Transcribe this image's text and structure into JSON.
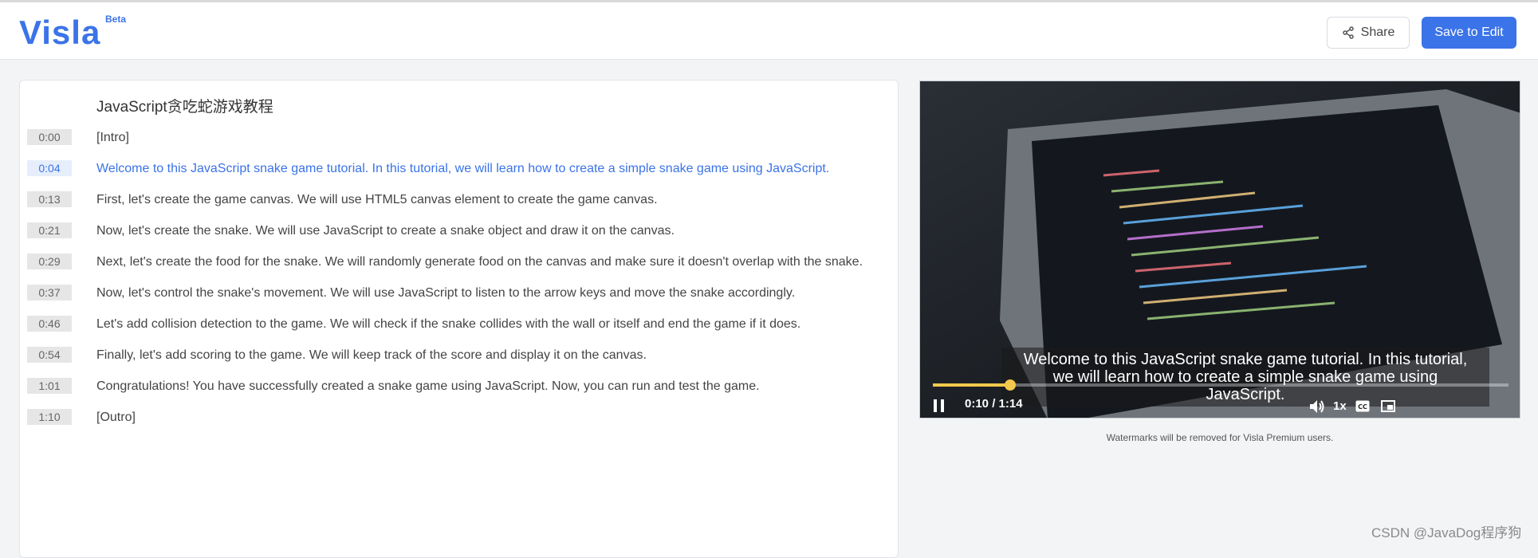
{
  "header": {
    "logo": "Visla",
    "beta": "Beta",
    "share_label": "Share",
    "save_label": "Save to Edit"
  },
  "transcript": {
    "title": "JavaScript贪吃蛇游戏教程",
    "active_index": 1,
    "rows": [
      {
        "time": "0:00",
        "text": "[Intro]"
      },
      {
        "time": "0:04",
        "text": "Welcome to this JavaScript snake game tutorial. In this tutorial, we will learn how to create a simple snake game using JavaScript."
      },
      {
        "time": "0:13",
        "text": "First, let's create the game canvas. We will use HTML5 canvas element to create the game canvas."
      },
      {
        "time": "0:21",
        "text": "Now, let's create the snake. We will use JavaScript to create a snake object and draw it on the canvas."
      },
      {
        "time": "0:29",
        "text": "Next, let's create the food for the snake. We will randomly generate food on the canvas and make sure it doesn't overlap with the snake."
      },
      {
        "time": "0:37",
        "text": "Now, let's control the snake's movement. We will use JavaScript to listen to the arrow keys and move the snake accordingly."
      },
      {
        "time": "0:46",
        "text": "Let's add collision detection to the game. We will check if the snake collides with the wall or itself and end the game if it does."
      },
      {
        "time": "0:54",
        "text": "Finally, let's add scoring to the game. We will keep track of the score and display it on the canvas."
      },
      {
        "time": "1:01",
        "text": "Congratulations! You have successfully created a snake game using JavaScript. Now, you can run and test the game."
      },
      {
        "time": "1:10",
        "text": "[Outro]"
      }
    ]
  },
  "player": {
    "caption_line1": "Welcome to this JavaScript snake game tutorial. In this tutorial,",
    "caption_line2": "we will learn how to create a simple snake game using",
    "caption_line3": "JavaScript.",
    "time_display": "0:10 / 1:14",
    "progress": 0.135,
    "speed": "1x",
    "icons": [
      "pause-icon",
      "volume-icon",
      "captions-icon",
      "fullscreen-icon"
    ]
  },
  "note": "Watermarks will be removed for Visla Premium users.",
  "watermark": "CSDN @JavaDog程序狗",
  "colors": {
    "accent": "#3b73e8",
    "progress": "#f2c94c"
  }
}
